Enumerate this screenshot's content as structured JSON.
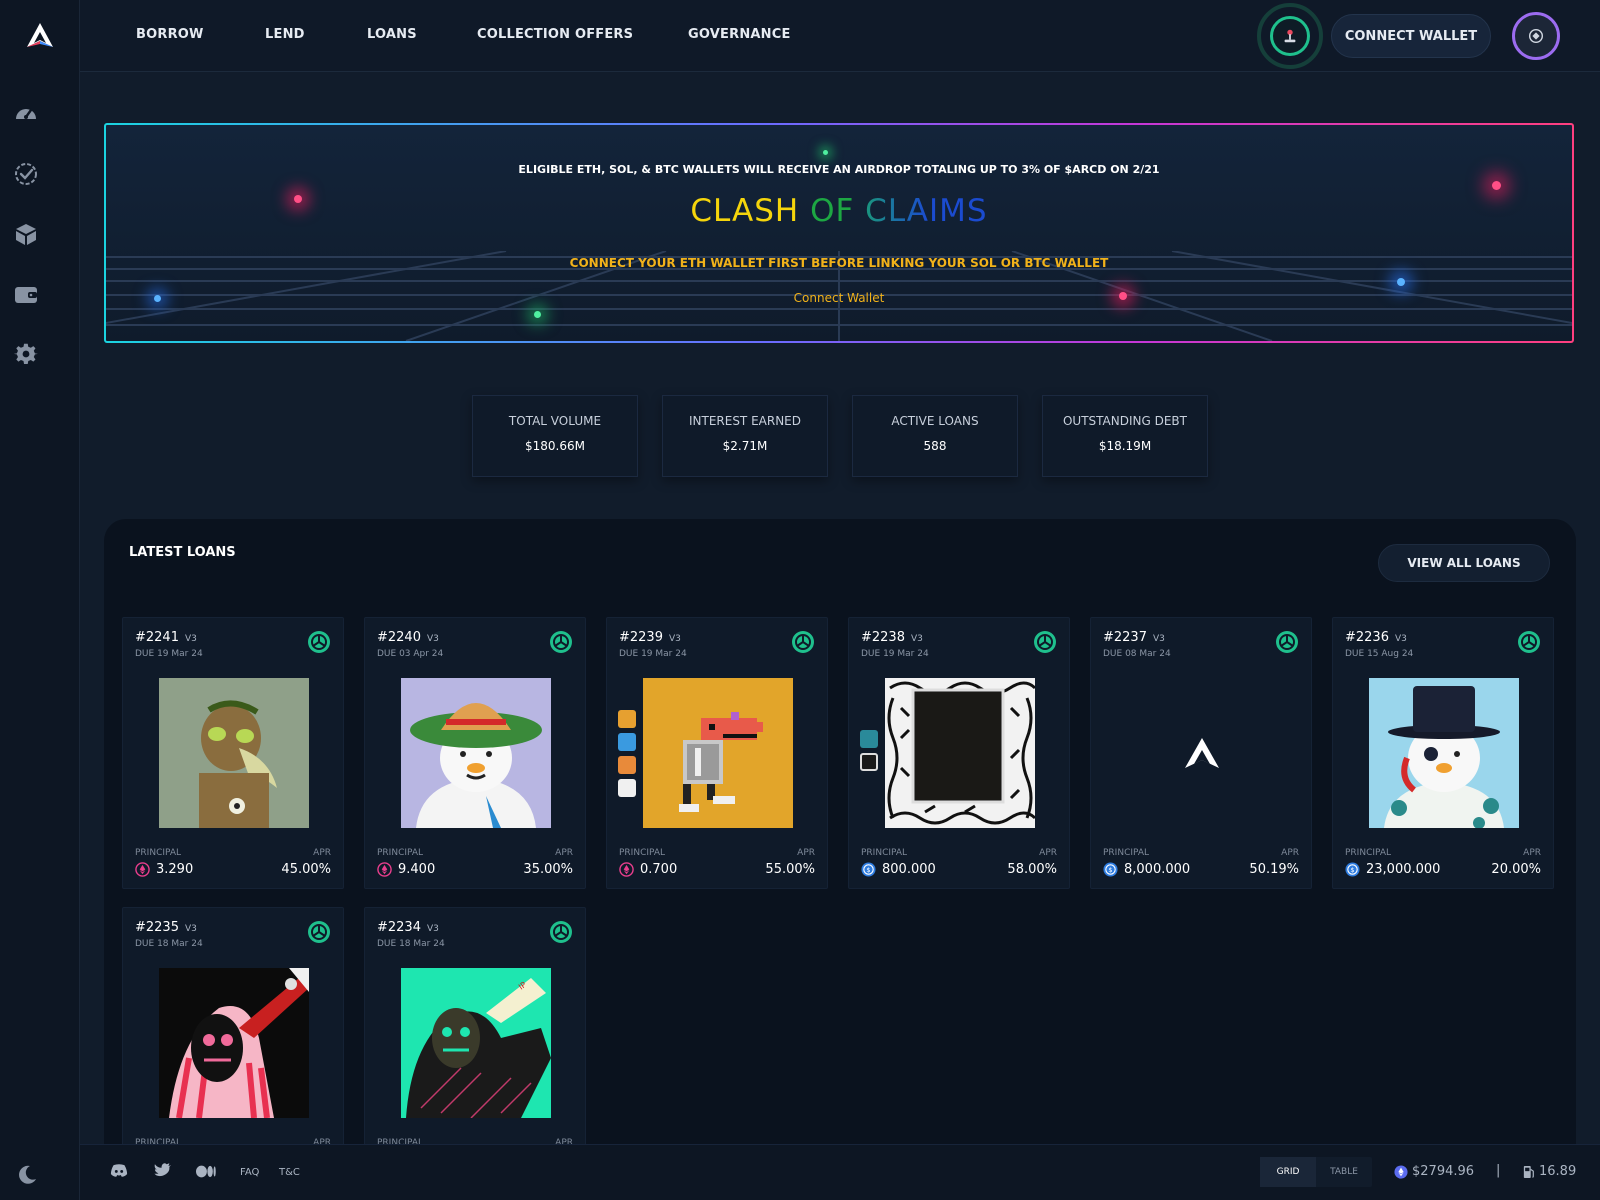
{
  "nav": {
    "items": [
      "BORROW",
      "LEND",
      "LOANS",
      "COLLECTION OFFERS",
      "GOVERNANCE"
    ],
    "connect_wallet": "CONNECT WALLET"
  },
  "sidebar": {
    "icons": [
      "dashboard-gauge-icon",
      "loans-check-icon",
      "box-icon",
      "wallet-icon",
      "settings-gear-icon"
    ]
  },
  "banner": {
    "subtitle": "ELIGIBLE ETH, SOL, & BTC WALLETS WILL RECEIVE AN AIRDROP TOTALING UP TO 3% OF $ARCD ON 2/21",
    "title_parts": [
      "CLASH",
      " OF",
      " CLAIMS"
    ],
    "title_colors": [
      "#f5d50c",
      "#1da743",
      "#1b4bd0"
    ],
    "note": "CONNECT YOUR ETH WALLET FIRST BEFORE LINKING YOUR SOL OR BTC WALLET",
    "link": "Connect Wallet"
  },
  "stats": [
    {
      "label": "TOTAL VOLUME",
      "value": "$180.66M"
    },
    {
      "label": "INTEREST EARNED",
      "value": "$2.71M"
    },
    {
      "label": "ACTIVE LOANS",
      "value": "588"
    },
    {
      "label": "OUTSTANDING DEBT",
      "value": "$18.19M"
    }
  ],
  "loans": {
    "title": "LATEST LOANS",
    "view_all": "VIEW ALL LOANS",
    "principal_label": "PRINCIPAL",
    "apr_label": "APR",
    "version": "V3",
    "cards": [
      {
        "id": "#2241",
        "due": "DUE 19 Mar 24",
        "principal": "3.290",
        "apr": "45.00%",
        "currency": "eth"
      },
      {
        "id": "#2240",
        "due": "DUE 03 Apr 24",
        "principal": "9.400",
        "apr": "35.00%",
        "currency": "eth"
      },
      {
        "id": "#2239",
        "due": "DUE 19 Mar 24",
        "principal": "0.700",
        "apr": "55.00%",
        "currency": "eth"
      },
      {
        "id": "#2238",
        "due": "DUE 19 Mar 24",
        "principal": "800.000",
        "apr": "58.00%",
        "currency": "usdc"
      },
      {
        "id": "#2237",
        "due": "DUE 08 Mar 24",
        "principal": "8,000.000",
        "apr": "50.19%",
        "currency": "usdc"
      },
      {
        "id": "#2236",
        "due": "DUE 15 Aug 24",
        "principal": "23,000.000",
        "apr": "20.00%",
        "currency": "usdc"
      },
      {
        "id": "#2235",
        "due": "DUE 18 Mar 24",
        "principal": "",
        "apr": "",
        "currency": ""
      },
      {
        "id": "#2234",
        "due": "DUE 18 Mar 24",
        "principal": "",
        "apr": "",
        "currency": ""
      }
    ]
  },
  "footer": {
    "links": [
      "FAQ",
      "T&C"
    ],
    "view_toggle": [
      "GRID",
      "TABLE"
    ],
    "eth_price": "$2794.96",
    "separator": "|",
    "gas": "16.89"
  },
  "colors": {
    "accent_green": "#1fc08d",
    "accent_purple": "#9c6cf0",
    "eth_pink": "#e83e8c",
    "usdc_blue": "#2f7de0",
    "banner_yellow": "#f1b21a"
  }
}
